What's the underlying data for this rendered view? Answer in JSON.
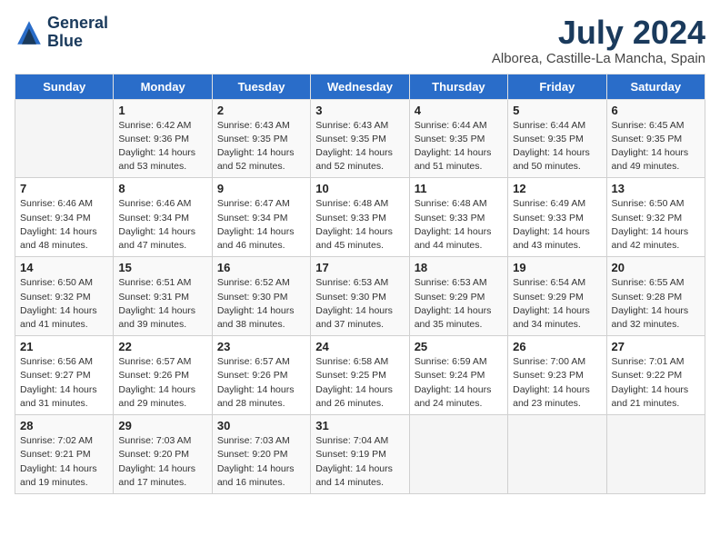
{
  "header": {
    "logo_line1": "General",
    "logo_line2": "Blue",
    "title": "July 2024",
    "subtitle": "Alborea, Castille-La Mancha, Spain"
  },
  "days_of_week": [
    "Sunday",
    "Monday",
    "Tuesday",
    "Wednesday",
    "Thursday",
    "Friday",
    "Saturday"
  ],
  "weeks": [
    [
      {
        "day": "",
        "info": ""
      },
      {
        "day": "1",
        "info": "Sunrise: 6:42 AM\nSunset: 9:36 PM\nDaylight: 14 hours\nand 53 minutes."
      },
      {
        "day": "2",
        "info": "Sunrise: 6:43 AM\nSunset: 9:35 PM\nDaylight: 14 hours\nand 52 minutes."
      },
      {
        "day": "3",
        "info": "Sunrise: 6:43 AM\nSunset: 9:35 PM\nDaylight: 14 hours\nand 52 minutes."
      },
      {
        "day": "4",
        "info": "Sunrise: 6:44 AM\nSunset: 9:35 PM\nDaylight: 14 hours\nand 51 minutes."
      },
      {
        "day": "5",
        "info": "Sunrise: 6:44 AM\nSunset: 9:35 PM\nDaylight: 14 hours\nand 50 minutes."
      },
      {
        "day": "6",
        "info": "Sunrise: 6:45 AM\nSunset: 9:35 PM\nDaylight: 14 hours\nand 49 minutes."
      }
    ],
    [
      {
        "day": "7",
        "info": "Sunrise: 6:46 AM\nSunset: 9:34 PM\nDaylight: 14 hours\nand 48 minutes."
      },
      {
        "day": "8",
        "info": "Sunrise: 6:46 AM\nSunset: 9:34 PM\nDaylight: 14 hours\nand 47 minutes."
      },
      {
        "day": "9",
        "info": "Sunrise: 6:47 AM\nSunset: 9:34 PM\nDaylight: 14 hours\nand 46 minutes."
      },
      {
        "day": "10",
        "info": "Sunrise: 6:48 AM\nSunset: 9:33 PM\nDaylight: 14 hours\nand 45 minutes."
      },
      {
        "day": "11",
        "info": "Sunrise: 6:48 AM\nSunset: 9:33 PM\nDaylight: 14 hours\nand 44 minutes."
      },
      {
        "day": "12",
        "info": "Sunrise: 6:49 AM\nSunset: 9:33 PM\nDaylight: 14 hours\nand 43 minutes."
      },
      {
        "day": "13",
        "info": "Sunrise: 6:50 AM\nSunset: 9:32 PM\nDaylight: 14 hours\nand 42 minutes."
      }
    ],
    [
      {
        "day": "14",
        "info": "Sunrise: 6:50 AM\nSunset: 9:32 PM\nDaylight: 14 hours\nand 41 minutes."
      },
      {
        "day": "15",
        "info": "Sunrise: 6:51 AM\nSunset: 9:31 PM\nDaylight: 14 hours\nand 39 minutes."
      },
      {
        "day": "16",
        "info": "Sunrise: 6:52 AM\nSunset: 9:30 PM\nDaylight: 14 hours\nand 38 minutes."
      },
      {
        "day": "17",
        "info": "Sunrise: 6:53 AM\nSunset: 9:30 PM\nDaylight: 14 hours\nand 37 minutes."
      },
      {
        "day": "18",
        "info": "Sunrise: 6:53 AM\nSunset: 9:29 PM\nDaylight: 14 hours\nand 35 minutes."
      },
      {
        "day": "19",
        "info": "Sunrise: 6:54 AM\nSunset: 9:29 PM\nDaylight: 14 hours\nand 34 minutes."
      },
      {
        "day": "20",
        "info": "Sunrise: 6:55 AM\nSunset: 9:28 PM\nDaylight: 14 hours\nand 32 minutes."
      }
    ],
    [
      {
        "day": "21",
        "info": "Sunrise: 6:56 AM\nSunset: 9:27 PM\nDaylight: 14 hours\nand 31 minutes."
      },
      {
        "day": "22",
        "info": "Sunrise: 6:57 AM\nSunset: 9:26 PM\nDaylight: 14 hours\nand 29 minutes."
      },
      {
        "day": "23",
        "info": "Sunrise: 6:57 AM\nSunset: 9:26 PM\nDaylight: 14 hours\nand 28 minutes."
      },
      {
        "day": "24",
        "info": "Sunrise: 6:58 AM\nSunset: 9:25 PM\nDaylight: 14 hours\nand 26 minutes."
      },
      {
        "day": "25",
        "info": "Sunrise: 6:59 AM\nSunset: 9:24 PM\nDaylight: 14 hours\nand 24 minutes."
      },
      {
        "day": "26",
        "info": "Sunrise: 7:00 AM\nSunset: 9:23 PM\nDaylight: 14 hours\nand 23 minutes."
      },
      {
        "day": "27",
        "info": "Sunrise: 7:01 AM\nSunset: 9:22 PM\nDaylight: 14 hours\nand 21 minutes."
      }
    ],
    [
      {
        "day": "28",
        "info": "Sunrise: 7:02 AM\nSunset: 9:21 PM\nDaylight: 14 hours\nand 19 minutes."
      },
      {
        "day": "29",
        "info": "Sunrise: 7:03 AM\nSunset: 9:20 PM\nDaylight: 14 hours\nand 17 minutes."
      },
      {
        "day": "30",
        "info": "Sunrise: 7:03 AM\nSunset: 9:20 PM\nDaylight: 14 hours\nand 16 minutes."
      },
      {
        "day": "31",
        "info": "Sunrise: 7:04 AM\nSunset: 9:19 PM\nDaylight: 14 hours\nand 14 minutes."
      },
      {
        "day": "",
        "info": ""
      },
      {
        "day": "",
        "info": ""
      },
      {
        "day": "",
        "info": ""
      }
    ]
  ]
}
